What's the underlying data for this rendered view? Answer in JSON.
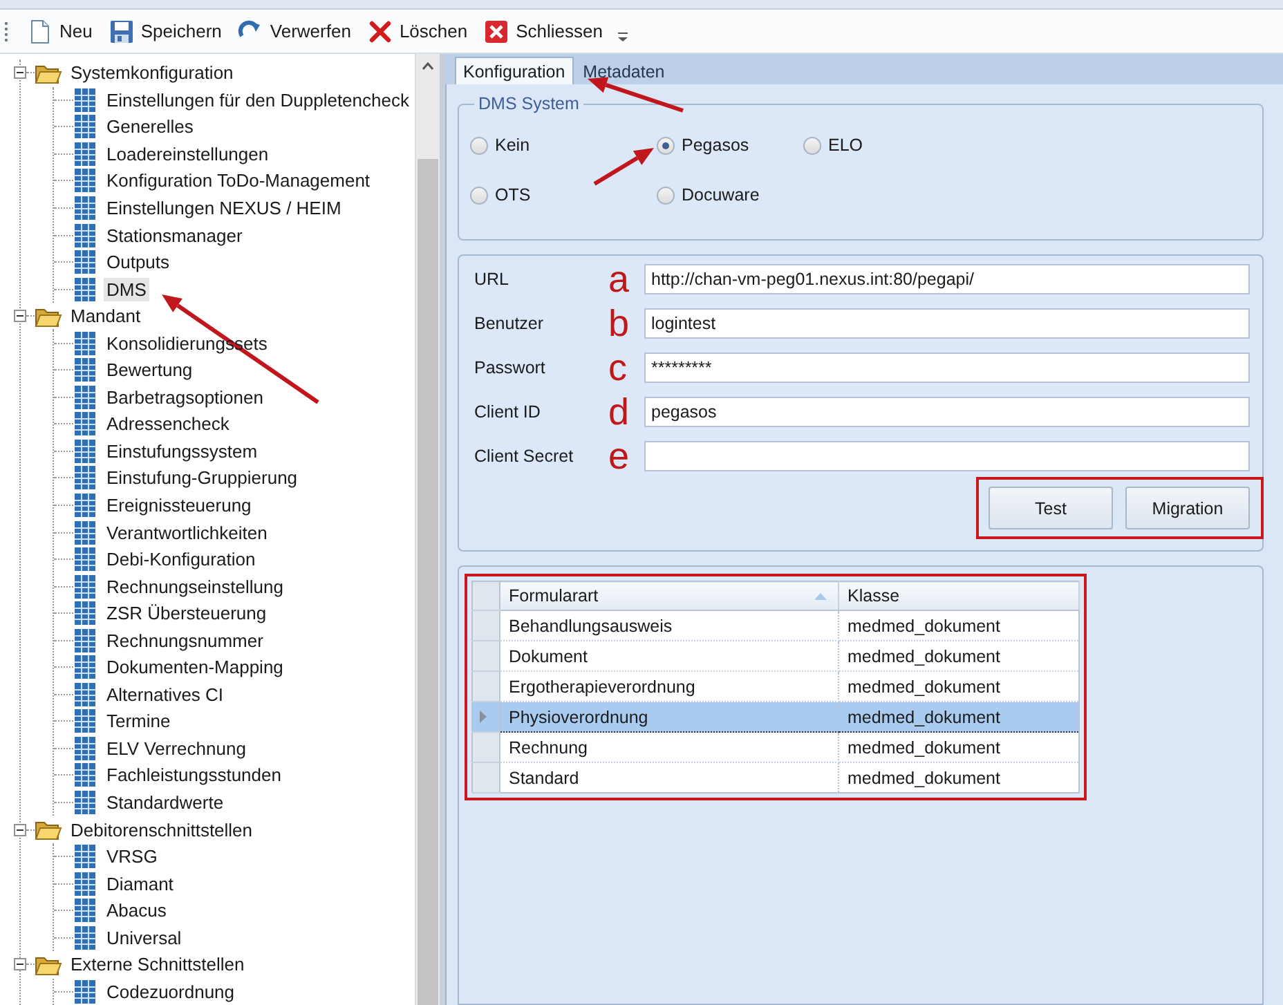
{
  "toolbar": {
    "buttons": [
      {
        "kind": "new",
        "label": "Neu"
      },
      {
        "kind": "save",
        "label": "Speichern"
      },
      {
        "kind": "discard",
        "label": "Verwerfen"
      },
      {
        "kind": "delete",
        "label": "Löschen"
      },
      {
        "kind": "close",
        "label": "Schliessen"
      }
    ]
  },
  "tree": [
    {
      "label": "Systemkonfiguration",
      "expanded": true,
      "selected": false,
      "children": [
        {
          "label": "Einstellungen für den Duppletencheck",
          "selected": false
        },
        {
          "label": "Generelles",
          "selected": false
        },
        {
          "label": "Loadereinstellungen",
          "selected": false
        },
        {
          "label": "Konfiguration ToDo-Management",
          "selected": false
        },
        {
          "label": "Einstellungen NEXUS / HEIM",
          "selected": false
        },
        {
          "label": "Stationsmanager",
          "selected": false
        },
        {
          "label": "Outputs",
          "selected": false
        },
        {
          "label": "DMS",
          "selected": true
        }
      ]
    },
    {
      "label": "Mandant",
      "expanded": true,
      "selected": false,
      "children": [
        {
          "label": "Konsolidierungssets",
          "selected": false
        },
        {
          "label": "Bewertung",
          "selected": false
        },
        {
          "label": "Barbetragsoptionen",
          "selected": false
        },
        {
          "label": "Adressencheck",
          "selected": false
        },
        {
          "label": "Einstufungssystem",
          "selected": false
        },
        {
          "label": "Einstufung-Gruppierung",
          "selected": false
        },
        {
          "label": "Ereignissteuerung",
          "selected": false
        },
        {
          "label": "Verantwortlichkeiten",
          "selected": false
        },
        {
          "label": "Debi-Konfiguration",
          "selected": false
        },
        {
          "label": "Rechnungseinstellung",
          "selected": false
        },
        {
          "label": "ZSR Übersteuerung",
          "selected": false
        },
        {
          "label": "Rechnungsnummer",
          "selected": false
        },
        {
          "label": "Dokumenten-Mapping",
          "selected": false
        },
        {
          "label": "Alternatives CI",
          "selected": false
        },
        {
          "label": "Termine",
          "selected": false
        },
        {
          "label": "ELV Verrechnung",
          "selected": false
        },
        {
          "label": "Fachleistungsstunden",
          "selected": false
        },
        {
          "label": "Standardwerte",
          "selected": false
        }
      ]
    },
    {
      "label": "Debitorenschnittstellen",
      "expanded": true,
      "selected": false,
      "children": [
        {
          "label": "VRSG",
          "selected": false
        },
        {
          "label": "Diamant",
          "selected": false
        },
        {
          "label": "Abacus",
          "selected": false
        },
        {
          "label": "Universal",
          "selected": false
        }
      ]
    },
    {
      "label": "Externe Schnittstellen",
      "expanded": true,
      "selected": false,
      "children": [
        {
          "label": "Codezuordnung",
          "selected": false
        }
      ]
    }
  ],
  "tabs": [
    {
      "label": "Konfiguration",
      "selected": true
    },
    {
      "label": "Metadaten",
      "selected": false
    }
  ],
  "dms_system": {
    "title": "DMS System",
    "options": [
      {
        "label": "Kein",
        "selected": false
      },
      {
        "label": "Pegasos",
        "selected": true
      },
      {
        "label": "ELO",
        "selected": false
      },
      {
        "label": "OTS",
        "selected": false
      },
      {
        "label": "Docuware",
        "selected": false
      }
    ]
  },
  "connection": {
    "fields": [
      {
        "label": "URL",
        "marker": "a",
        "value": "http://chan-vm-peg01.nexus.int:80/pegapi/"
      },
      {
        "label": "Benutzer",
        "marker": "b",
        "value": "logintest"
      },
      {
        "label": "Passwort",
        "marker": "c",
        "value": "*********"
      },
      {
        "label": "Client ID",
        "marker": "d",
        "value": "pegasos"
      },
      {
        "label": "Client Secret",
        "marker": "e"
      }
    ],
    "buttons": [
      "Test",
      "Migration"
    ]
  },
  "table": {
    "columns": [
      {
        "label": "Formularart",
        "sorted": true
      },
      {
        "label": "Klasse",
        "sorted": false
      }
    ],
    "rows": [
      {
        "cells": [
          "Behandlungsausweis",
          "medmed_dokument"
        ],
        "selected": false
      },
      {
        "cells": [
          "Dokument",
          "medmed_dokument"
        ],
        "selected": false
      },
      {
        "cells": [
          "Ergotherapieverordnung",
          "medmed_dokument"
        ],
        "selected": false
      },
      {
        "cells": [
          "Physioverordnung",
          "medmed_dokument"
        ],
        "selected": true
      },
      {
        "cells": [
          "Rechnung",
          "medmed_dokument"
        ],
        "selected": false
      },
      {
        "cells": [
          "Standard",
          "medmed_dokument"
        ],
        "selected": false
      }
    ]
  }
}
